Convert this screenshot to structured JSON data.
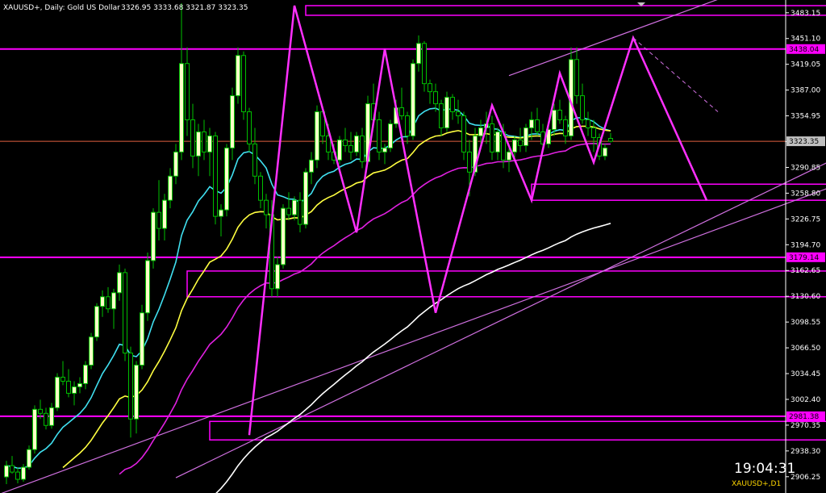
{
  "header": {
    "title": "XAUUSD+, Daily: Gold US Dollar",
    "ohlc": "3326.95 3333.68 3321.87 3323.35"
  },
  "footer": {
    "clock": "19:04:31",
    "symbol": "XAUUSD+,D1"
  },
  "colors": {
    "background": "#000000",
    "bull_candle": "#ffffc8",
    "bear_candle": "#000000",
    "candle_outline": "#00c000",
    "level_line": "#ff00ff",
    "price_line": "#e06040",
    "ma_fast": "#40e0f0",
    "ma_mid": "#ffff40",
    "ma_slow": "#e020e0",
    "ma_long": "#ffffff"
  },
  "chart_data": {
    "type": "candlestick",
    "ylim": [
      2890.0,
      3497.0
    ],
    "y_ticks": [
      "3483.15",
      "3451.10",
      "3419.05",
      "3387.00",
      "3354.95",
      "3322.90",
      "3290.85",
      "3258.80",
      "3226.75",
      "3194.70",
      "3162.65",
      "3130.60",
      "3098.55",
      "3066.50",
      "3034.45",
      "3002.40",
      "2970.35",
      "2938.30",
      "2906.25"
    ],
    "current_price_tag": "3323.35",
    "current_price": 3323.35,
    "level_tags": [
      {
        "price": 3438.04,
        "label": "3438.04"
      },
      {
        "price": 3179.14,
        "label": "3179.14"
      },
      {
        "price": 2981.38,
        "label": "2981.38"
      }
    ],
    "candles": [
      [
        2906,
        2926,
        2897,
        2920
      ],
      [
        2920,
        2932,
        2910,
        2912
      ],
      [
        2912,
        2918,
        2898,
        2903
      ],
      [
        2903,
        2922,
        2900,
        2918
      ],
      [
        2918,
        2945,
        2915,
        2940
      ],
      [
        2940,
        2995,
        2935,
        2990
      ],
      [
        2990,
        3002,
        2978,
        2985
      ],
      [
        2985,
        2992,
        2965,
        2970
      ],
      [
        2970,
        2998,
        2966,
        2992
      ],
      [
        2992,
        3035,
        2988,
        3030
      ],
      [
        3030,
        3050,
        3020,
        3025
      ],
      [
        3025,
        3040,
        3005,
        3010
      ],
      [
        3010,
        3025,
        2995,
        3018
      ],
      [
        3018,
        3030,
        3010,
        3022
      ],
      [
        3022,
        3050,
        3015,
        3045
      ],
      [
        3045,
        3085,
        3040,
        3080
      ],
      [
        3080,
        3122,
        3075,
        3118
      ],
      [
        3118,
        3138,
        3105,
        3130
      ],
      [
        3130,
        3142,
        3110,
        3115
      ],
      [
        3115,
        3140,
        3090,
        3135
      ],
      [
        3135,
        3170,
        3125,
        3160
      ],
      [
        3160,
        3165,
        3050,
        3060
      ],
      [
        3060,
        3068,
        2955,
        2978
      ],
      [
        2978,
        3050,
        2960,
        3045
      ],
      [
        3045,
        3120,
        3040,
        3110
      ],
      [
        3110,
        3185,
        3100,
        3175
      ],
      [
        3175,
        3240,
        3165,
        3235
      ],
      [
        3235,
        3275,
        3200,
        3215
      ],
      [
        3215,
        3258,
        3200,
        3250
      ],
      [
        3250,
        3290,
        3240,
        3280
      ],
      [
        3280,
        3320,
        3270,
        3310
      ],
      [
        3310,
        3495,
        3300,
        3420
      ],
      [
        3420,
        3440,
        3330,
        3350
      ],
      [
        3350,
        3370,
        3290,
        3305
      ],
      [
        3305,
        3345,
        3280,
        3335
      ],
      [
        3335,
        3350,
        3300,
        3310
      ],
      [
        3310,
        3340,
        3280,
        3330
      ],
      [
        3330,
        3335,
        3220,
        3230
      ],
      [
        3230,
        3245,
        3205,
        3238
      ],
      [
        3238,
        3320,
        3230,
        3315
      ],
      [
        3315,
        3390,
        3300,
        3380
      ],
      [
        3380,
        3440,
        3370,
        3430
      ],
      [
        3430,
        3435,
        3350,
        3360
      ],
      [
        3360,
        3365,
        3310,
        3320
      ],
      [
        3320,
        3340,
        3270,
        3280
      ],
      [
        3280,
        3285,
        3240,
        3250
      ],
      [
        3250,
        3258,
        3215,
        3232
      ],
      [
        3232,
        3250,
        3130,
        3140
      ],
      [
        3140,
        3180,
        3130,
        3170
      ],
      [
        3170,
        3245,
        3165,
        3240
      ],
      [
        3240,
        3260,
        3225,
        3232
      ],
      [
        3232,
        3255,
        3225,
        3250
      ],
      [
        3250,
        3260,
        3210,
        3220
      ],
      [
        3220,
        3290,
        3215,
        3285
      ],
      [
        3285,
        3310,
        3270,
        3300
      ],
      [
        3300,
        3368,
        3290,
        3360
      ],
      [
        3360,
        3365,
        3320,
        3330
      ],
      [
        3330,
        3345,
        3300,
        3310
      ],
      [
        3310,
        3320,
        3295,
        3300
      ],
      [
        3300,
        3330,
        3295,
        3325
      ],
      [
        3325,
        3340,
        3310,
        3318
      ],
      [
        3318,
        3335,
        3300,
        3310
      ],
      [
        3310,
        3335,
        3305,
        3330
      ],
      [
        3330,
        3340,
        3290,
        3298
      ],
      [
        3298,
        3380,
        3295,
        3370
      ],
      [
        3370,
        3395,
        3340,
        3350
      ],
      [
        3350,
        3360,
        3300,
        3310
      ],
      [
        3310,
        3320,
        3295,
        3315
      ],
      [
        3315,
        3350,
        3310,
        3345
      ],
      [
        3345,
        3375,
        3340,
        3365
      ],
      [
        3365,
        3390,
        3350,
        3355
      ],
      [
        3355,
        3360,
        3320,
        3330
      ],
      [
        3330,
        3425,
        3325,
        3420
      ],
      [
        3420,
        3455,
        3410,
        3445
      ],
      [
        3445,
        3448,
        3385,
        3395
      ],
      [
        3395,
        3400,
        3370,
        3385
      ],
      [
        3385,
        3395,
        3360,
        3370
      ],
      [
        3370,
        3375,
        3330,
        3340
      ],
      [
        3340,
        3385,
        3335,
        3378
      ],
      [
        3378,
        3382,
        3350,
        3360
      ],
      [
        3360,
        3375,
        3345,
        3355
      ],
      [
        3355,
        3360,
        3300,
        3310
      ],
      [
        3310,
        3325,
        3255,
        3285
      ],
      [
        3285,
        3340,
        3280,
        3330
      ],
      [
        3330,
        3350,
        3315,
        3340
      ],
      [
        3340,
        3360,
        3320,
        3345
      ],
      [
        3345,
        3355,
        3300,
        3310
      ],
      [
        3310,
        3340,
        3300,
        3335
      ],
      [
        3335,
        3345,
        3290,
        3300
      ],
      [
        3300,
        3315,
        3285,
        3310
      ],
      [
        3310,
        3330,
        3300,
        3325
      ],
      [
        3325,
        3340,
        3310,
        3318
      ],
      [
        3318,
        3345,
        3310,
        3340
      ],
      [
        3340,
        3360,
        3325,
        3350
      ],
      [
        3350,
        3365,
        3330,
        3335
      ],
      [
        3335,
        3345,
        3310,
        3320
      ],
      [
        3320,
        3342,
        3315,
        3338
      ],
      [
        3338,
        3370,
        3330,
        3362
      ],
      [
        3362,
        3375,
        3345,
        3350
      ],
      [
        3350,
        3355,
        3320,
        3330
      ],
      [
        3330,
        3440,
        3325,
        3425
      ],
      [
        3425,
        3440,
        3370,
        3380
      ],
      [
        3380,
        3395,
        3345,
        3350
      ],
      [
        3350,
        3360,
        3330,
        3340
      ],
      [
        3340,
        3350,
        3310,
        3328
      ],
      [
        3328,
        3333,
        3300,
        3305
      ],
      [
        3305,
        3320,
        3300,
        3315
      ],
      [
        3326.95,
        3333.68,
        3321.87,
        3323.35
      ]
    ],
    "zigzag": [
      [
        43,
        2958
      ],
      [
        51,
        3492
      ],
      [
        62,
        3210
      ],
      [
        67,
        3438
      ],
      [
        76,
        3110
      ],
      [
        86,
        3368
      ],
      [
        93,
        3250
      ],
      [
        98,
        3408
      ],
      [
        104,
        3297
      ],
      [
        111,
        3452
      ],
      [
        124,
        3250
      ]
    ],
    "dashed_segment": [
      [
        111,
        3452
      ],
      [
        126,
        3360
      ]
    ],
    "channel_lines": [
      {
        "from": [
          -3,
          2880
        ],
        "to": [
          186,
          3370
        ]
      },
      {
        "from": [
          30,
          2905
        ],
        "to": [
          186,
          3435
        ]
      },
      {
        "from": [
          89,
          3405
        ],
        "to": [
          130,
          3510
        ]
      }
    ],
    "boxes": [
      {
        "x0": 53,
        "x1": 179,
        "top": 3492,
        "bottom": 3480
      },
      {
        "x0": 93,
        "x1": 179,
        "top": 3270,
        "bottom": 3250
      },
      {
        "x0": 32,
        "x1": 179,
        "top": 3162,
        "bottom": 3130
      },
      {
        "x0": 36,
        "x1": 179,
        "top": 2975,
        "bottom": 2952
      }
    ]
  }
}
